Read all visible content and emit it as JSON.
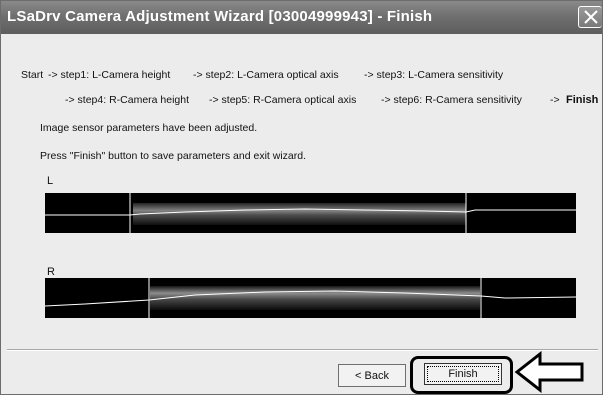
{
  "window": {
    "title": "LSaDrv Camera Adjustment Wizard [03004999943] - Finish"
  },
  "steps": {
    "start": "Start",
    "step1": "-> step1: L-Camera height",
    "step2": "-> step2: L-Camera optical axis",
    "step3": "-> step3: L-Camera sensitivity",
    "step4": "-> step4: R-Camera height",
    "step5": "-> step5: R-Camera optical axis",
    "step6": "-> step6: R-Camera sensitivity",
    "finish_prefix": "->",
    "finish": "Finish"
  },
  "messages": {
    "line1": "Image sensor parameters have been adjusted.",
    "line2": "Press \"Finish\" button to save parameters and exit wizard."
  },
  "cameras": {
    "left_label": "L",
    "right_label": "R"
  },
  "buttons": {
    "back": "< Back",
    "finish": "Finish"
  },
  "icons": {
    "close": "close-icon",
    "pointer_arrow": "left-arrow-icon"
  },
  "colors": {
    "titlebar": "#707070",
    "panel": "#ececec",
    "sensor_bg": "#000000",
    "signal": "#ffffff"
  }
}
